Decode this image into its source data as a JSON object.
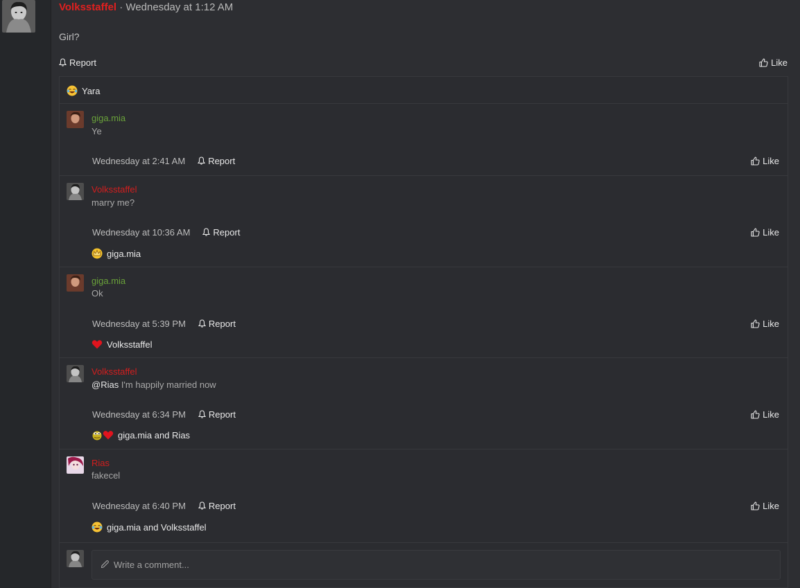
{
  "post": {
    "author": "Volksstaffel",
    "separator": "·",
    "timestamp": "Wednesday at 1:12 AM",
    "body": "Girl?",
    "report_label": "Report",
    "like_label": "Like",
    "reaction": {
      "icon": "laughing-tears-emoji",
      "users": "Yara"
    }
  },
  "comments": [
    {
      "author": "giga.mia",
      "author_color": "#6aa23a",
      "text": "Ye",
      "time": "Wednesday at 2:41 AM",
      "report": "Report",
      "like": "Like"
    },
    {
      "author": "Volksstaffel",
      "author_color": "#d31e1e",
      "text": "marry me?",
      "time": "Wednesday at 10:36 AM",
      "report": "Report",
      "like": "Like",
      "reaction": {
        "icon": "crown-emoji",
        "users": "giga.mia"
      }
    },
    {
      "author": "giga.mia",
      "author_color": "#6aa23a",
      "text": "Ok",
      "time": "Wednesday at 5:39 PM",
      "report": "Report",
      "like": "Like",
      "reaction": {
        "icon": "heart-emoji",
        "users": "Volksstaffel"
      }
    },
    {
      "author": "Volksstaffel",
      "author_color": "#d31e1e",
      "mention": "@Rias",
      "text": " I'm happily married now",
      "time": "Wednesday at 6:34 PM",
      "report": "Report",
      "like": "Like",
      "reaction": {
        "icon": "pepe-and-heart-emoji",
        "users": "giga.mia and Rias"
      }
    },
    {
      "author": "Rias",
      "author_color": "#d31e1e",
      "text": "fakecel",
      "time": "Wednesday at 6:40 PM",
      "report": "Report",
      "like": "Like",
      "reaction": {
        "icon": "laughing-tears-emoji",
        "users": "giga.mia and Volksstaffel"
      }
    }
  ],
  "compose": {
    "placeholder": "Write a comment..."
  },
  "colors": {
    "accent_red": "#e0201f",
    "green_user": "#6aa23a",
    "background": "#2d2e32"
  }
}
